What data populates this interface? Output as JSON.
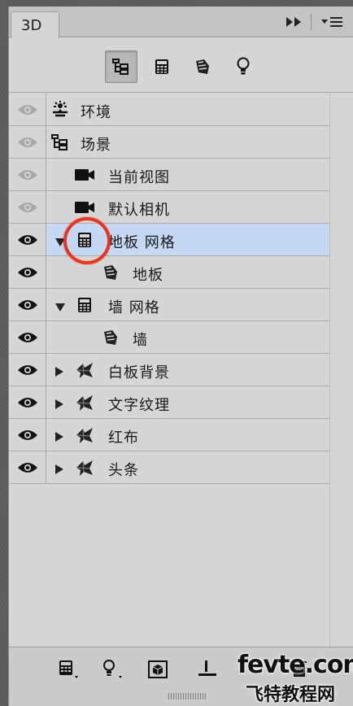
{
  "panel": {
    "tab_label": "3D"
  },
  "toolbar_icons": [
    "collapse-icon",
    "panel-menu-icon"
  ],
  "filters": [
    {
      "name": "scene-filter",
      "icon": "scene-tree-icon",
      "active": true
    },
    {
      "name": "mesh-filter",
      "icon": "mesh-icon",
      "active": false
    },
    {
      "name": "material-filter",
      "icon": "material-icon",
      "active": false
    },
    {
      "name": "light-filter",
      "icon": "light-bulb-icon",
      "active": false
    }
  ],
  "layers": [
    {
      "label": "环境",
      "icon": "environment-icon",
      "eye": "dim",
      "expand": "none",
      "indent": 0
    },
    {
      "label": "场景",
      "icon": "scene-tree-icon",
      "eye": "dim",
      "expand": "none",
      "indent": 0
    },
    {
      "label": "当前视图",
      "icon": "camera-icon",
      "eye": "dim",
      "expand": "none",
      "indent": 1
    },
    {
      "label": "默认相机",
      "icon": "camera-icon",
      "eye": "dim",
      "expand": "none",
      "indent": 1
    },
    {
      "label": "地板 网格",
      "icon": "mesh-icon",
      "eye": "visible",
      "expand": "expanded",
      "indent": 0,
      "selected": true
    },
    {
      "label": "地板",
      "icon": "material-icon",
      "eye": "visible",
      "expand": "none",
      "indent": 2
    },
    {
      "label": "墙 网格",
      "icon": "mesh-icon",
      "eye": "visible",
      "expand": "expanded",
      "indent": 0
    },
    {
      "label": "墙",
      "icon": "material-icon",
      "eye": "visible",
      "expand": "none",
      "indent": 2
    },
    {
      "label": "白板背景",
      "icon": "3d-object-icon",
      "eye": "visible",
      "expand": "collapsed",
      "indent": 0
    },
    {
      "label": "文字纹理",
      "icon": "3d-object-icon",
      "eye": "visible",
      "expand": "collapsed",
      "indent": 0
    },
    {
      "label": "红布",
      "icon": "3d-object-icon",
      "eye": "visible",
      "expand": "collapsed",
      "indent": 0
    },
    {
      "label": "头条",
      "icon": "3d-object-icon",
      "eye": "visible",
      "expand": "collapsed",
      "indent": 0
    }
  ],
  "bottom_bar": [
    "new-mesh-icon",
    "new-light-icon",
    "render-icon",
    "ground-icon",
    "delete-icon"
  ],
  "watermark": {
    "domain": "fevte.com",
    "site_name": "飞特教程网"
  },
  "colors": {
    "selected_row": "#c5d9f4",
    "annotation_circle": "#e8361c",
    "panel_bg": "#d6d6d6"
  }
}
